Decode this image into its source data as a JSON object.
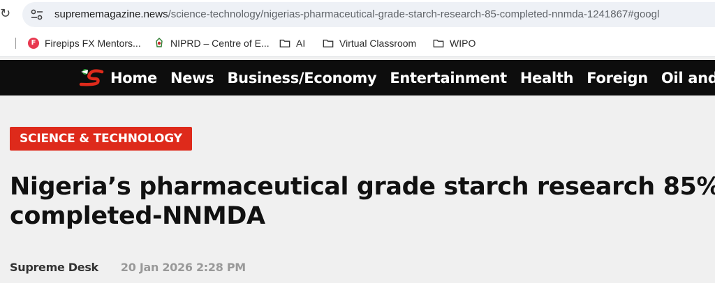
{
  "browser": {
    "url_domain": "suprememagazine.news",
    "url_path": "/science-technology/nigerias-pharmaceutical-grade-starch-research-85-completed-nnmda-1241867#googl",
    "bookmarks": [
      {
        "label": "Firepips FX Mentors...",
        "icon": "firepips-favicon"
      },
      {
        "label": "NIPRD – Centre of E...",
        "icon": "niprd-favicon"
      },
      {
        "label": "AI",
        "icon": "folder-icon"
      },
      {
        "label": "Virtual Classroom",
        "icon": "folder-icon"
      },
      {
        "label": "WIPO",
        "icon": "folder-icon"
      }
    ]
  },
  "site": {
    "nav": [
      "Home",
      "News",
      "Business/Economy",
      "Entertainment",
      "Health",
      "Foreign",
      "Oil and Gas"
    ],
    "accent_color": "#de2a1b"
  },
  "article": {
    "category": "SCIENCE & TECHNOLOGY",
    "headline": "Nigeria’s pharmaceutical grade starch research 85% completed-NNMDA",
    "author": "Supreme Desk",
    "date": "20 Jan 2026 2:28 PM"
  }
}
